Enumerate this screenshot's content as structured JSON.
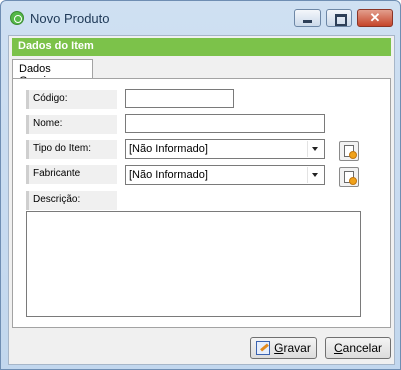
{
  "window": {
    "title": "Novo Produto"
  },
  "header": {
    "title": "Dados do Item"
  },
  "tabs": [
    {
      "label": "Dados Gerais"
    }
  ],
  "form": {
    "codigo": {
      "label": "Código:",
      "value": ""
    },
    "nome": {
      "label": "Nome:",
      "value": ""
    },
    "tipo_item": {
      "label": "Tipo do Item:",
      "selected": "[Não Informado]"
    },
    "fabricante": {
      "label": "Fabricante",
      "selected": "[Não Informado]"
    },
    "descricao": {
      "label": "Descrição:",
      "value": ""
    }
  },
  "buttons": {
    "save_mnemonic": "G",
    "save_rest": "ravar",
    "cancel_mnemonic": "C",
    "cancel_rest": "ancelar"
  },
  "colors": {
    "header_green": "#7cc24a",
    "window_frame": "#c2d7ee"
  },
  "icons": [
    "app-refresh-icon",
    "minimize-icon",
    "maximize-icon",
    "close-icon",
    "add-new-icon",
    "save-icon"
  ]
}
